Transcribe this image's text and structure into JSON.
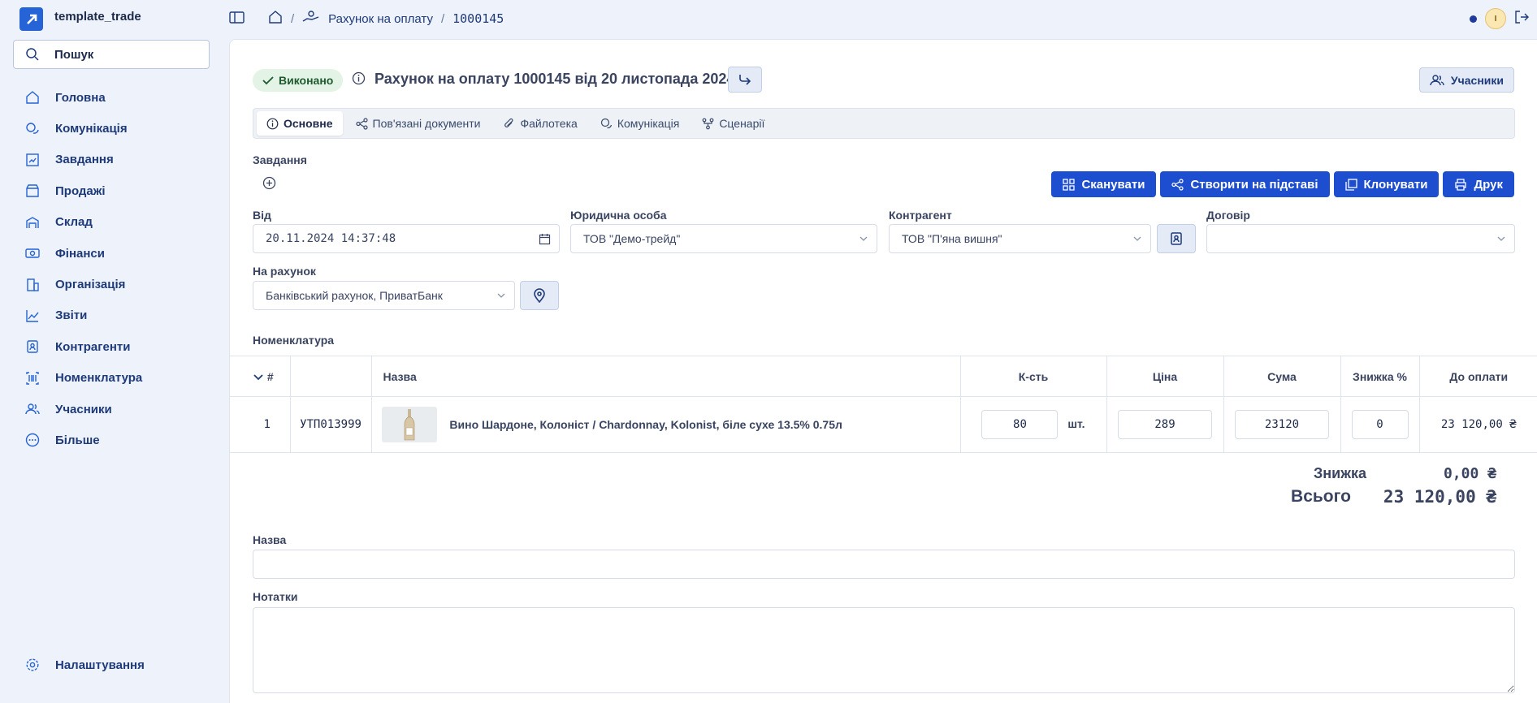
{
  "app": {
    "name": "template_trade"
  },
  "search": {
    "label": "Пошук"
  },
  "sidebar": {
    "items": [
      {
        "label": "Головна",
        "icon": "home-icon"
      },
      {
        "label": "Комунікація",
        "icon": "chat-icon"
      },
      {
        "label": "Завдання",
        "icon": "tasks-icon"
      },
      {
        "label": "Продажі",
        "icon": "store-icon"
      },
      {
        "label": "Склад",
        "icon": "warehouse-icon"
      },
      {
        "label": "Фінанси",
        "icon": "money-icon"
      },
      {
        "label": "Організація",
        "icon": "building-icon"
      },
      {
        "label": "Звіти",
        "icon": "chart-icon"
      },
      {
        "label": "Контрагенти",
        "icon": "contacts-icon"
      },
      {
        "label": "Номенклатура",
        "icon": "barcode-icon"
      },
      {
        "label": "Учасники",
        "icon": "users-icon"
      },
      {
        "label": "Більше",
        "icon": "more-icon"
      }
    ],
    "settings": "Налаштування"
  },
  "breadcrumb": {
    "section": "Рахунок на оплату",
    "number": "1000145"
  },
  "doc": {
    "status": "Виконано",
    "title": "Рахунок на оплату 1000145 від 20 листопада 2024",
    "members_button": "Учасники"
  },
  "tabs": [
    {
      "label": "Основне",
      "icon": "info-icon",
      "active": true
    },
    {
      "label": "Пов'язані документи",
      "icon": "links-icon"
    },
    {
      "label": "Файлотека",
      "icon": "paperclip-icon"
    },
    {
      "label": "Комунікація",
      "icon": "chat-icon"
    },
    {
      "label": "Сценарії",
      "icon": "flow-icon"
    }
  ],
  "tasks_label": "Завдання",
  "actions": {
    "scan": "Сканувати",
    "create_based": "Створити на підставі",
    "clone": "Клонувати",
    "print": "Друк"
  },
  "form": {
    "from_label": "Від",
    "from_value": "20.11.2024 14:37:48",
    "legal_label": "Юридична особа",
    "legal_value": "ТОВ \"Демо-трейд\"",
    "counterparty_label": "Контрагент",
    "counterparty_value": "ТОВ \"П'яна вишня\"",
    "contract_label": "Договір",
    "contract_value": "",
    "account_label": "На рахунок",
    "account_value": "Банківський рахунок, ПриватБанк",
    "nomenclature_label": "Номенклатура",
    "name_label": "Назва",
    "name_value": "",
    "notes_label": "Нотатки"
  },
  "table": {
    "headers": {
      "num": "#",
      "name": "Назва",
      "qty": "К-сть",
      "price": "Ціна",
      "sum": "Сума",
      "discount": "Знижка %",
      "payable": "До оплати"
    },
    "rows": [
      {
        "num": "1",
        "code": "УТП013999",
        "name": "Вино Шардоне, Колоніст / Chardonnay, Kolonist, біле сухе 13.5% 0.75л",
        "qty": "80",
        "unit": "шт.",
        "price": "289",
        "sum": "23120",
        "discount": "0",
        "payable": "23 120,00 ₴"
      }
    ]
  },
  "totals": {
    "discount_label": "Знижка",
    "discount_value": "0,00 ₴",
    "total_label": "Всього",
    "total_value": "23 120,00 ₴"
  },
  "colors": {
    "primary": "#1d4ecf",
    "status_bg": "#e3f3e6",
    "status_text": "#1e5a2e"
  }
}
